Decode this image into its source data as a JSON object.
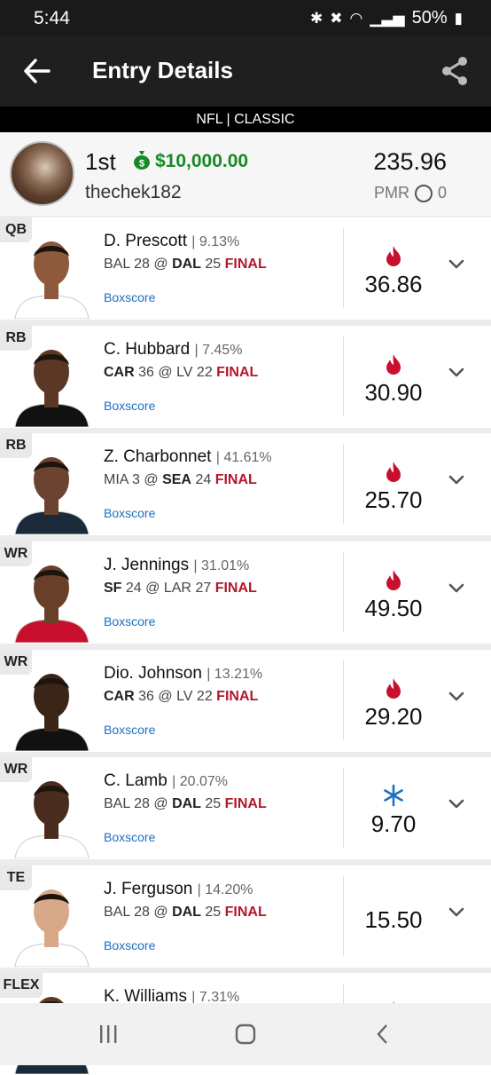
{
  "status": {
    "time": "5:44",
    "battery": "50%",
    "icons": [
      "bluetooth-icon",
      "mute-icon",
      "wifi-icon",
      "signal-icon",
      "battery-icon"
    ]
  },
  "header": {
    "title": "Entry Details",
    "subtitle": "NFL | CLASSIC"
  },
  "summary": {
    "rank": "1st",
    "prize": "$10,000.00",
    "username": "thechek182",
    "total": "235.96",
    "pmr_label": "PMR",
    "pmr_value": "0"
  },
  "players": [
    {
      "pos": "QB",
      "name": "D. Prescott",
      "own": "9.13%",
      "team1": "BAL",
      "score1": "28",
      "sep": "@",
      "team2": "DAL",
      "score2": "25",
      "bold_team": 2,
      "status": "FINAL",
      "box": "Boxscore",
      "pts": "36.86",
      "streak": "hot",
      "skin": "#8d5a3b",
      "jersey": "#ffffff"
    },
    {
      "pos": "RB",
      "name": "C. Hubbard",
      "own": "7.45%",
      "team1": "CAR",
      "score1": "36",
      "sep": "@",
      "team2": "LV",
      "score2": "22",
      "bold_team": 1,
      "status": "FINAL",
      "box": "Boxscore",
      "pts": "30.90",
      "streak": "hot",
      "skin": "#5b3826",
      "jersey": "#111111"
    },
    {
      "pos": "RB",
      "name": "Z. Charbonnet",
      "own": "41.61%",
      "team1": "MIA",
      "score1": "3",
      "sep": "@",
      "team2": "SEA",
      "score2": "24",
      "bold_team": 2,
      "status": "FINAL",
      "box": "Boxscore",
      "pts": "25.70",
      "streak": "hot",
      "skin": "#6b4330",
      "jersey": "#1b2a3a"
    },
    {
      "pos": "WR",
      "name": "J. Jennings",
      "own": "31.01%",
      "team1": "SF",
      "score1": "24",
      "sep": "@",
      "team2": "LAR",
      "score2": "27",
      "bold_team": 1,
      "status": "FINAL",
      "box": "Boxscore",
      "pts": "49.50",
      "streak": "hot",
      "skin": "#6a3f2a",
      "jersey": "#c8102e"
    },
    {
      "pos": "WR",
      "name": "Dio. Johnson",
      "own": "13.21%",
      "team1": "CAR",
      "score1": "36",
      "sep": "@",
      "team2": "LV",
      "score2": "22",
      "bold_team": 1,
      "status": "FINAL",
      "box": "Boxscore",
      "pts": "29.20",
      "streak": "hot",
      "skin": "#3b2418",
      "jersey": "#111111"
    },
    {
      "pos": "WR",
      "name": "C. Lamb",
      "own": "20.07%",
      "team1": "BAL",
      "score1": "28",
      "sep": "@",
      "team2": "DAL",
      "score2": "25",
      "bold_team": 2,
      "status": "FINAL",
      "box": "Boxscore",
      "pts": "9.70",
      "streak": "cold",
      "skin": "#4a2c1e",
      "jersey": "#ffffff"
    },
    {
      "pos": "TE",
      "name": "J. Ferguson",
      "own": "14.20%",
      "team1": "BAL",
      "score1": "28",
      "sep": "@",
      "team2": "DAL",
      "score2": "25",
      "bold_team": 2,
      "status": "FINAL",
      "box": "Boxscore",
      "pts": "15.50",
      "streak": "none",
      "skin": "#d8a989",
      "jersey": "#ffffff"
    },
    {
      "pos": "FLEX",
      "name": "K. Williams",
      "own": "7.31%",
      "team1": "",
      "score1": "",
      "sep": "",
      "team2": "",
      "score2": "",
      "bold_team": 0,
      "status": "",
      "box": "",
      "pts": "",
      "streak": "hot",
      "skin": "#5b3826",
      "jersey": "#1b2a3a"
    }
  ],
  "colors": {
    "final": "#b3182b",
    "prize": "#178a26",
    "link": "#1e6fc1",
    "hot": "#c8102e",
    "cold": "#1e6fc1"
  }
}
